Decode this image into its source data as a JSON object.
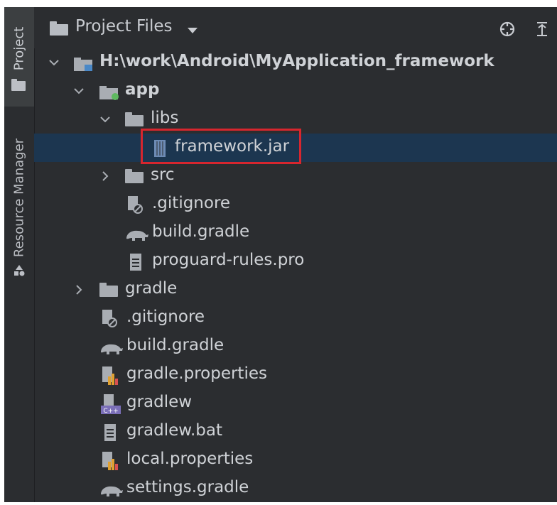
{
  "side_strip": {
    "project_tab": "Project",
    "resource_manager_tab": "Resource Manager"
  },
  "header": {
    "title": "Project Files",
    "locate_icon": "crosshair-icon",
    "collapse_icon": "collapse-all-icon"
  },
  "tree": {
    "root": "H:\\work\\Android\\MyApplication_framework",
    "app": "app",
    "libs": "libs",
    "framework_jar": "framework.jar",
    "src": "src",
    "app_gitignore": ".gitignore",
    "app_build_gradle": "build.gradle",
    "proguard": "proguard-rules.pro",
    "gradle": "gradle",
    "root_gitignore": ".gitignore",
    "root_build_gradle": "build.gradle",
    "gradle_properties": "gradle.properties",
    "gradlew": "gradlew",
    "gradlew_bat": "gradlew.bat",
    "local_properties": "local.properties",
    "settings_gradle": "settings.gradle"
  },
  "colors": {
    "background": "#2b2d30",
    "selection": "#1c3650",
    "highlight_box": "#d7262e"
  }
}
